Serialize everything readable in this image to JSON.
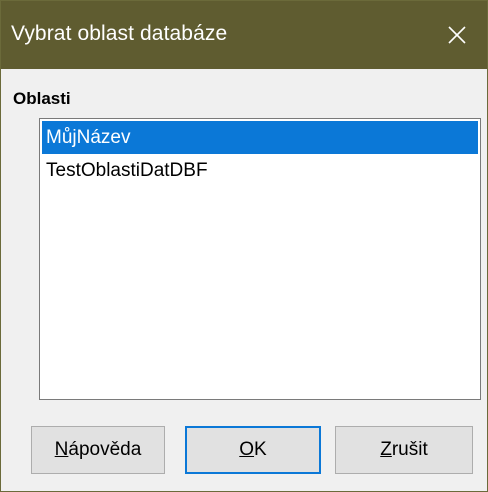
{
  "window": {
    "title": "Vybrat oblast databáze",
    "close_icon": "close-icon"
  },
  "areas": {
    "label": "Oblasti",
    "items": [
      {
        "label": "MůjNázev",
        "selected": true
      },
      {
        "label": "TestOblastiDatDBF",
        "selected": false
      }
    ]
  },
  "buttons": {
    "help": {
      "mnemonic": "N",
      "rest": "ápověda"
    },
    "ok": {
      "mnemonic": "O",
      "rest": "K"
    },
    "cancel": {
      "mnemonic": "Z",
      "rest": "rušit"
    }
  },
  "colors": {
    "titlebar": "#5f5c30",
    "selection": "#0b78d7"
  }
}
